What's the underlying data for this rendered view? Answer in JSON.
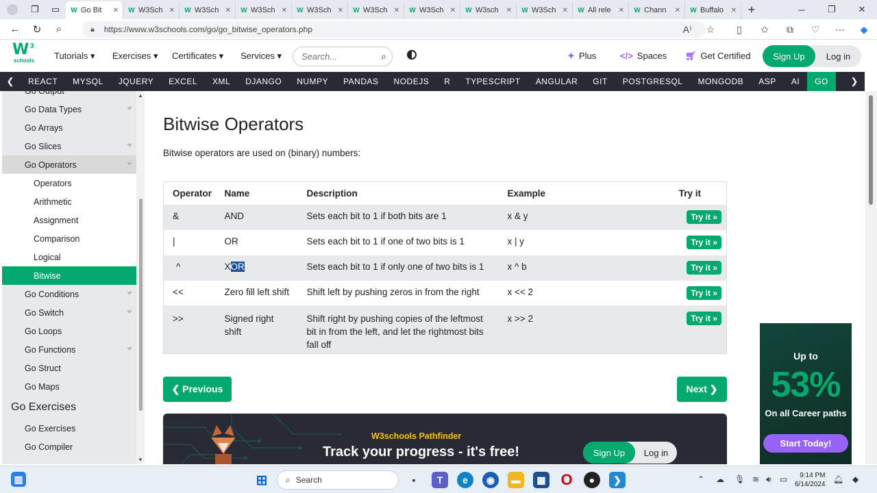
{
  "browser": {
    "tabs": [
      {
        "label": "Go Bit",
        "active": true
      },
      {
        "label": "W3Sch"
      },
      {
        "label": "W3Sch"
      },
      {
        "label": "W3Sch"
      },
      {
        "label": "W3Sch"
      },
      {
        "label": "W3Sch"
      },
      {
        "label": "W3Sch"
      },
      {
        "label": "W3sch"
      },
      {
        "label": "W3Sch"
      },
      {
        "label": "All rele"
      },
      {
        "label": "Chann"
      },
      {
        "label": "Buffalo"
      }
    ],
    "url": "https://www.w3schools.com/go/go_bitwise_operators.php",
    "read_aloud": "A⁾"
  },
  "header": {
    "logo_text": "W",
    "logo_sup": "3",
    "logo_sub": "schools",
    "menu": [
      "Tutorials",
      "Exercises",
      "Certificates",
      "Services"
    ],
    "search_placeholder": "Search...",
    "plus": "Plus",
    "spaces": "Spaces",
    "get_certified": "Get Certified",
    "sign_up": "Sign Up",
    "log_in": "Log in"
  },
  "topnav": [
    "REACT",
    "MYSQL",
    "JQUERY",
    "EXCEL",
    "XML",
    "DJANGO",
    "NUMPY",
    "PANDAS",
    "NODEJS",
    "R",
    "TYPESCRIPT",
    "ANGULAR",
    "GIT",
    "POSTGRESQL",
    "MONGODB",
    "ASP",
    "AI",
    "GO"
  ],
  "sidebar": {
    "items": [
      {
        "label": "Go Output",
        "level": 1
      },
      {
        "label": "Go Data Types",
        "level": 1,
        "caret": true
      },
      {
        "label": "Go Arrays",
        "level": 1
      },
      {
        "label": "Go Slices",
        "level": 1,
        "caret": true
      },
      {
        "label": "Go Operators",
        "level": 1,
        "caret": true,
        "highlight": true
      },
      {
        "label": "Operators",
        "level": 2
      },
      {
        "label": "Arithmetic",
        "level": 2
      },
      {
        "label": "Assignment",
        "level": 2
      },
      {
        "label": "Comparison",
        "level": 2
      },
      {
        "label": "Logical",
        "level": 2
      },
      {
        "label": "Bitwise",
        "level": 2,
        "active": true
      },
      {
        "label": "Go Conditions",
        "level": 1,
        "caret": true
      },
      {
        "label": "Go Switch",
        "level": 1,
        "caret": true
      },
      {
        "label": "Go Loops",
        "level": 1
      },
      {
        "label": "Go Functions",
        "level": 1,
        "caret": true
      },
      {
        "label": "Go Struct",
        "level": 1
      },
      {
        "label": "Go Maps",
        "level": 1
      }
    ],
    "exercises_heading": "Go Exercises",
    "exercise_items": [
      "Go Exercises",
      "Go Compiler"
    ]
  },
  "main": {
    "title": "Bitwise Operators",
    "intro": "Bitwise operators are used on (binary) numbers:",
    "table": {
      "headers": [
        "Operator",
        "Name",
        "Description",
        "Example",
        "Try it"
      ],
      "rows": [
        {
          "op": "&",
          "name": "AND",
          "desc": "Sets each bit to 1 if both bits are 1",
          "example": "x & y"
        },
        {
          "op": "|",
          "name": "OR",
          "desc": "Sets each bit to 1 if one of two bits is 1",
          "example": "x | y"
        },
        {
          "op": "^",
          "name_a": "X",
          "name_b": "OR",
          "desc": "Sets each bit to 1 if only one of two bits is 1",
          "example": "x ^ b"
        },
        {
          "op": "<<",
          "name": "Zero fill left shift",
          "desc": "Shift left by pushing zeros in from the right",
          "example": "x << 2"
        },
        {
          "op": ">>",
          "name": "Signed right shift",
          "desc": "Shift right by pushing copies of the leftmost bit in from the left, and let the rightmost bits fall off",
          "example": "x >> 2"
        }
      ],
      "try_label": "Try it »"
    },
    "prev_label": "❮ Previous",
    "next_label": "Next ❯",
    "banner": {
      "small": "W3schools Pathfinder",
      "big": "Track your progress - it's free!",
      "sign_up": "Sign Up",
      "log_in": "Log in"
    }
  },
  "ad": {
    "line1": "Up to",
    "line2": "53%",
    "line3": "On all Career paths",
    "button": "Start Today!"
  },
  "taskbar": {
    "search": "Search",
    "time": "9:14 PM",
    "date": "6/14/2024"
  },
  "colors": {
    "accent": "#04aa6d",
    "nav_dark": "#282a35",
    "purple": "#9763f6"
  }
}
